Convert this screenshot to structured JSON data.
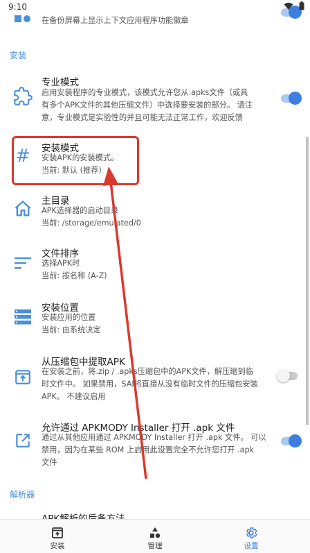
{
  "status_bar": {
    "time": "9:10",
    "wifi_icon": "wifi-icon",
    "battery_icon": "battery-icon"
  },
  "top_item": {
    "summary": "在备份屏幕上显示上下文应用程序功能徽章",
    "icon": "badge-icon",
    "toggle_on": true
  },
  "sections": {
    "install": "安装",
    "parser": "解析器"
  },
  "items": {
    "pro_mode": {
      "title": "专业模式",
      "summary": [
        "启用安装程序的专业模式，该模式允许您从.apks文件（或具",
        "有多个APK文件的其他压缩文件）中选择要安装的部分。 请注",
        "意，专业模式是实验性的并且可能无法正常工作，欢迎反馈"
      ],
      "icon": "puzzle-icon",
      "toggle_on": true
    },
    "install_mode": {
      "title": "安装模式",
      "summary": [
        "安装APK的安装模式。",
        "当前: 默认 (推荐)"
      ],
      "icon": "hash-icon"
    },
    "home_dir": {
      "title": "主目录",
      "summary": [
        "APK选择器的启动目录",
        "当前: /storage/emulated/0"
      ],
      "icon": "home-icon"
    },
    "file_sort": {
      "title": "文件排序",
      "summary": [
        "选择APK时",
        "当前: 按名称 (A-Z)"
      ],
      "icon": "sort-icon"
    },
    "install_location": {
      "title": "安装位置",
      "summary": [
        "安装应用的位置",
        "当前: 由系统决定"
      ],
      "icon": "storage-icon"
    },
    "extract_apk": {
      "title": "从压缩包中提取APK",
      "summary": [
        "在安装之前，将.zip / .apks压缩包中的APK文件，解压缩到临",
        "时文件中。 如果禁用，SAI将直接从没有临时文件的压缩包安装",
        "APK。 不建议启用"
      ],
      "icon": "archive-icon",
      "toggle_on": false
    },
    "allow_open": {
      "title": "允许通过 APKMODY Installer 打开 .apk 文件",
      "summary": [
        "通过从其他应用通过 APKMODY Installer 打开 .apk 文件。 可以",
        "禁用，因为在某些 ROM 上启用此设置完全不允许您打开 .apk",
        "文件"
      ],
      "icon": "open-external-icon",
      "toggle_on": true
    },
    "parser_item": {
      "title": "APK解析的后备方法"
    }
  },
  "colors": {
    "accent": "#3d7fe0",
    "highlight": "#d93a2e"
  },
  "bottom_nav": {
    "install": {
      "label": "安装",
      "icon": "install-icon"
    },
    "manage": {
      "label": "管理",
      "icon": "shapes-icon"
    },
    "settings": {
      "label": "设置",
      "icon": "gear-icon",
      "active": true
    }
  }
}
